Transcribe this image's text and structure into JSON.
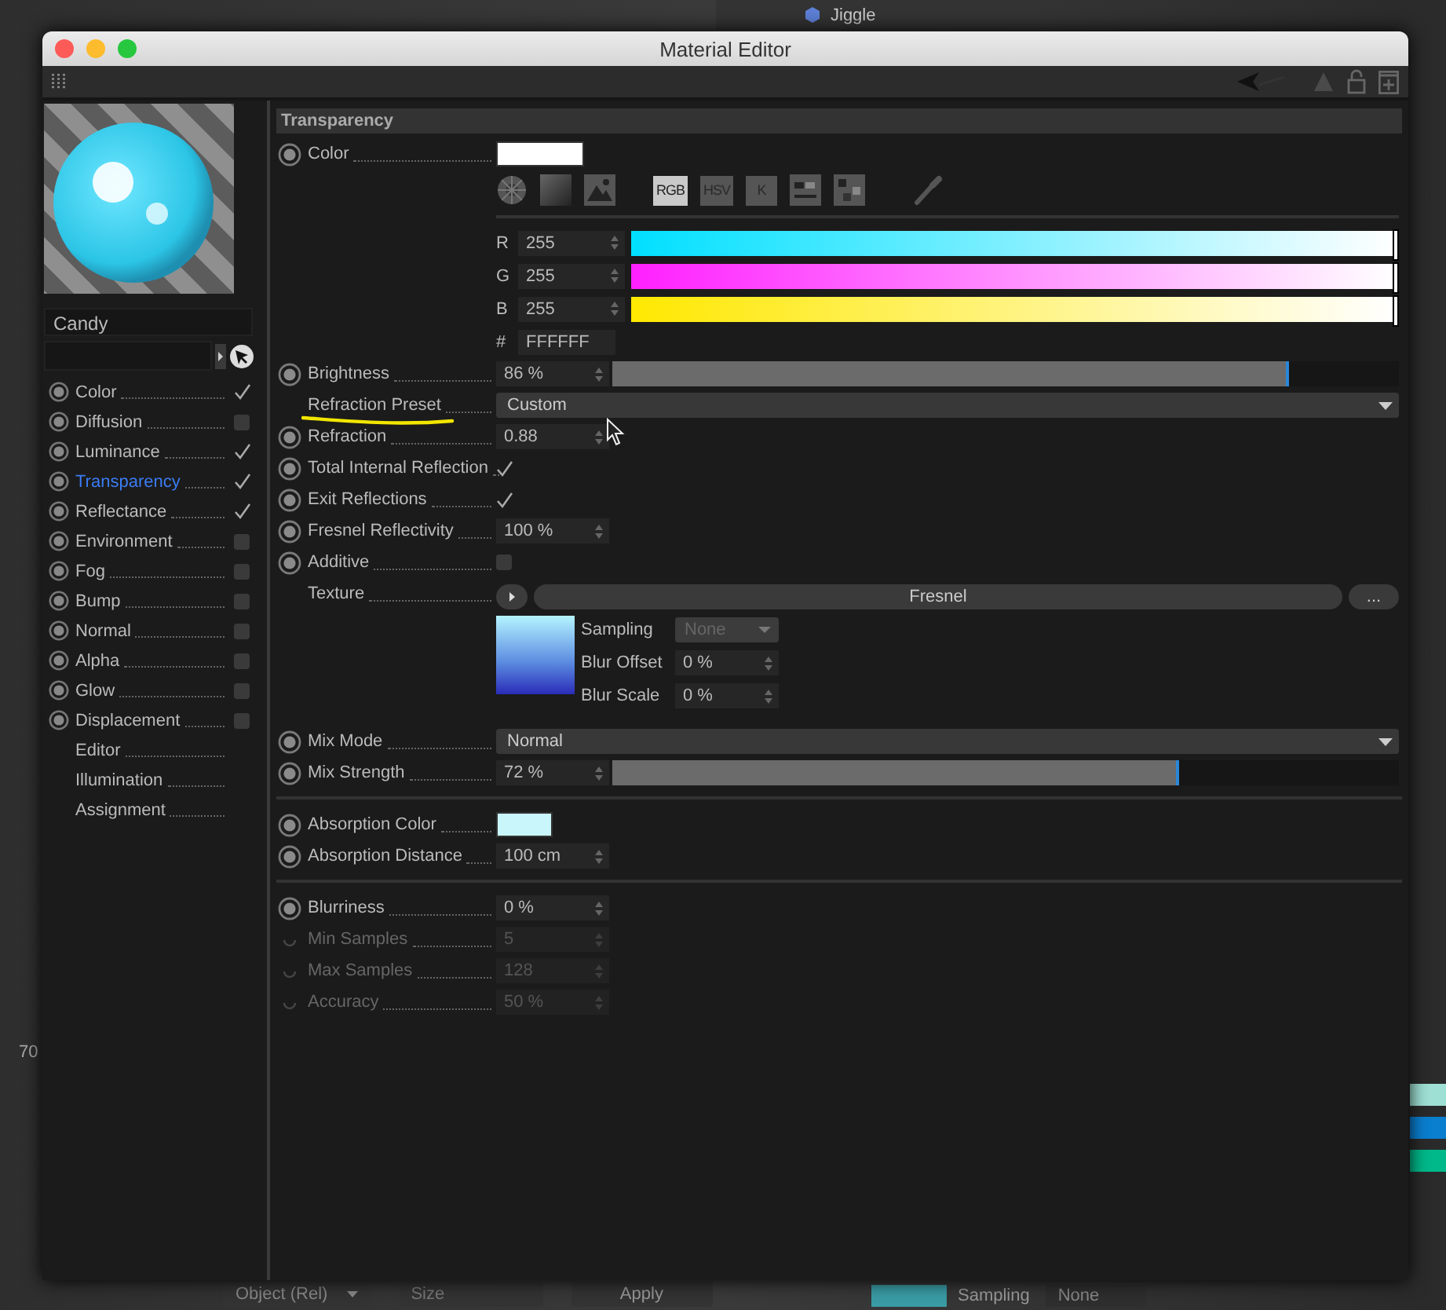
{
  "background": {
    "tree_item": "Jiggle",
    "ruler_value": "70",
    "coord_mode": "Object (Rel)",
    "size_mode": "Size",
    "apply": "Apply",
    "sampling_label": "Sampling",
    "sampling_value": "None"
  },
  "window": {
    "title": "Material Editor"
  },
  "material": {
    "name": "Candy"
  },
  "channels": [
    {
      "label": "Color",
      "kind": "channel",
      "checked": true,
      "selected": false
    },
    {
      "label": "Diffusion",
      "kind": "channel",
      "checked": false,
      "selected": false
    },
    {
      "label": "Luminance",
      "kind": "channel",
      "checked": true,
      "selected": false
    },
    {
      "label": "Transparency",
      "kind": "channel",
      "checked": true,
      "selected": true
    },
    {
      "label": "Reflectance",
      "kind": "channel",
      "checked": true,
      "selected": false
    },
    {
      "label": "Environment",
      "kind": "channel",
      "checked": false,
      "selected": false
    },
    {
      "label": "Fog",
      "kind": "channel",
      "checked": false,
      "selected": false
    },
    {
      "label": "Bump",
      "kind": "channel",
      "checked": false,
      "selected": false
    },
    {
      "label": "Normal",
      "kind": "channel",
      "checked": false,
      "selected": false
    },
    {
      "label": "Alpha",
      "kind": "channel",
      "checked": false,
      "selected": false
    },
    {
      "label": "Glow",
      "kind": "channel",
      "checked": false,
      "selected": false
    },
    {
      "label": "Displacement",
      "kind": "channel",
      "checked": false,
      "selected": false
    },
    {
      "label": "Editor",
      "kind": "page",
      "selected": false
    },
    {
      "label": "Illumination",
      "kind": "page",
      "selected": false
    },
    {
      "label": "Assignment",
      "kind": "page",
      "selected": false
    }
  ],
  "section": {
    "title": "Transparency"
  },
  "attributes": [
    {
      "kind": "color",
      "label": "Color",
      "animatable": true,
      "color": "#ffffff",
      "modes": [
        {
          "label": "RGB",
          "selected": true
        },
        {
          "label": "HSV",
          "selected": false
        },
        {
          "label": "K",
          "selected": false
        }
      ],
      "channels": [
        {
          "letter": "R",
          "value": "255",
          "color": "#00e0ff",
          "level": 1
        },
        {
          "letter": "G",
          "value": "255",
          "color": "#ff20ff",
          "level": 1
        },
        {
          "letter": "B",
          "value": "255",
          "color": "#ffe800",
          "level": 1
        }
      ],
      "hex_symbol": "#",
      "hex": "FFFFFF"
    },
    {
      "kind": "slider",
      "label": "Brightness",
      "animatable": true,
      "value": "86 %",
      "level": 0.86
    },
    {
      "kind": "dropdown",
      "label": "Refraction Preset",
      "animatable": false,
      "highlighted": true,
      "value": "Custom"
    },
    {
      "kind": "number",
      "label": "Refraction",
      "animatable": true,
      "value": "0.88",
      "disabled": false
    },
    {
      "kind": "check",
      "label": "Total Internal Reflection",
      "animatable": true,
      "checked": true
    },
    {
      "kind": "check",
      "label": "Exit Reflections",
      "animatable": true,
      "checked": true
    },
    {
      "kind": "number",
      "label": "Fresnel Reflectivity",
      "animatable": true,
      "value": "100 %",
      "disabled": false
    },
    {
      "kind": "check",
      "label": "Additive",
      "animatable": true,
      "checked": false
    },
    {
      "kind": "texture",
      "label": "Texture",
      "animatable": false,
      "value": "Fresnel",
      "more": "...",
      "sampling": {
        "label": "Sampling",
        "value": "None",
        "disabled": true
      },
      "fields": [
        {
          "label": "Blur Offset",
          "value": "0 %"
        },
        {
          "label": "Blur Scale",
          "value": "0 %"
        }
      ]
    },
    {
      "kind": "dropdown",
      "label": "Mix Mode",
      "animatable": true,
      "highlighted": false,
      "value": "Normal"
    },
    {
      "kind": "slider",
      "label": "Mix Strength",
      "animatable": true,
      "value": "72 %",
      "level": 0.72
    },
    {
      "kind": "divider"
    },
    {
      "kind": "swatch",
      "label": "Absorption Color",
      "animatable": true,
      "color": "#c8f6fb"
    },
    {
      "kind": "number",
      "label": "Absorption Distance",
      "animatable": true,
      "value": "100 cm",
      "disabled": false
    },
    {
      "kind": "divider"
    },
    {
      "kind": "number",
      "label": "Blurriness",
      "animatable": true,
      "value": "0 %",
      "disabled": false
    },
    {
      "kind": "number",
      "label": "Min Samples",
      "animatable": true,
      "value": "5",
      "disabled": true
    },
    {
      "kind": "number",
      "label": "Max Samples",
      "animatable": true,
      "value": "128",
      "disabled": true
    },
    {
      "kind": "number",
      "label": "Accuracy",
      "animatable": true,
      "value": "50 %",
      "disabled": true
    }
  ]
}
